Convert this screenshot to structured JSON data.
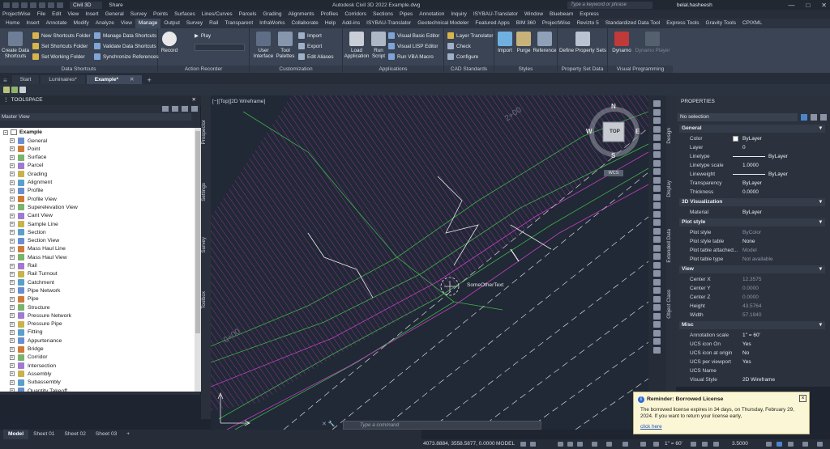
{
  "titlebar": {
    "product": "Civil 3D",
    "share": "Share",
    "app_title": "Autodesk Civil 3D 2022   Example.dwg",
    "search_placeholder": "Type a keyword or phrase",
    "user": "belal.hasheesh",
    "win_min": "—",
    "win_max": "□",
    "win_close": "✕"
  },
  "menu": [
    "ProjectWise",
    "File",
    "Edit",
    "View",
    "Insert",
    "General",
    "Survey",
    "Points",
    "Surfaces",
    "Lines/Curves",
    "Parcels",
    "Grading",
    "Alignments",
    "Profiles",
    "Corridors",
    "Sections",
    "Pipes",
    "Annotation",
    "Inquiry",
    "ISYBAU-Translator",
    "Window",
    "Bluebeam",
    "Express"
  ],
  "ribbon_tabs": [
    "Home",
    "Insert",
    "Annotate",
    "Modify",
    "Analyze",
    "View",
    "Manage",
    "Output",
    "Survey",
    "Rail",
    "Transparent",
    "InfraWorks",
    "Collaborate",
    "Help",
    "Add-ins",
    "ISYBAU-Translator",
    "Geotechnical Modeler",
    "Featured Apps",
    "BIM 360",
    "ProjectWise",
    "Revizto 5",
    "Standardized Data Tool",
    "Express Tools",
    "Gravity Tools",
    "CPIXML"
  ],
  "ribbon_active": "Manage",
  "ribbon": {
    "data_shortcuts": {
      "title": "Data Shortcuts",
      "create": "Create Data Shortcuts",
      "items": [
        "New Shortcuts Folder",
        "Set Shortcuts Folder",
        "Set Working Folder",
        "Manage Data Shortcuts",
        "Validate Data Shortcuts",
        "Synchronize References"
      ]
    },
    "action_recorder": {
      "title": "Action Recorder",
      "record": "Record",
      "play": "Play"
    },
    "customization": {
      "title": "Customization",
      "user_interface": "User Interface",
      "tool_palettes": "Tool Palettes",
      "import": "Import",
      "export": "Export",
      "edit_aliases": "Edit Aliases"
    },
    "applications": {
      "title": "Applications",
      "load_application": "Load Application",
      "run_script": "Run Script",
      "vb_editor": "Visual Basic Editor",
      "lisp_editor": "Visual LISP Editor",
      "vba_macro": "Run VBA Macro"
    },
    "cad_standards": {
      "title": "CAD Standards",
      "layer_translator": "Layer Translator",
      "check": "Check",
      "configure": "Configure"
    },
    "styles": {
      "title": "Styles",
      "import": "Import",
      "purge": "Purge",
      "reference": "Reference"
    },
    "property_set": {
      "title": "Property Set Data",
      "define": "Define Property Sets"
    },
    "visual_programming": {
      "title": "Visual Programming",
      "dynamo": "Dynamo",
      "dynamo_player": "Dynamo Player"
    }
  },
  "doc_tabs": [
    {
      "label": "Start",
      "active": false
    },
    {
      "label": "Luminaires*",
      "active": false
    },
    {
      "label": "Example*",
      "active": true
    }
  ],
  "toolspace": {
    "title": "TOOLSPACE",
    "view": "Master View",
    "root": "Example",
    "items": [
      "General",
      "Point",
      "Surface",
      "Parcel",
      "Grading",
      "Alignment",
      "Profile",
      "Profile View",
      "Superelevation View",
      "Cant View",
      "Sample Line",
      "Section",
      "Section View",
      "Mass Haul Line",
      "Mass Haul View",
      "Rail",
      "Rail Turnout",
      "Catchment",
      "Pipe Network",
      "Pipe",
      "Structure",
      "Pressure Network",
      "Pressure Pipe",
      "Fitting",
      "Appurtenance",
      "Bridge",
      "Corridor",
      "Intersection",
      "Assembly",
      "Subassembly",
      "Quantity Takeoff"
    ],
    "side_tabs": [
      "Prospector",
      "Settings",
      "Survey",
      "Toolbox"
    ]
  },
  "viewport": {
    "label": "[−][Top][2D Wireframe]",
    "viewcube_face": "TOP",
    "compass": {
      "n": "N",
      "s": "S",
      "e": "E",
      "w": "W"
    },
    "wcs": "WCS",
    "annotation": "SomeOtherText",
    "station_labels": [
      "2+00",
      "0+00"
    ],
    "command_placeholder": "Type a command"
  },
  "properties": {
    "title": "PROPERTIES",
    "selection": "No selection",
    "side_tabs": [
      "Design",
      "Display",
      "Extended Data",
      "Object Class"
    ],
    "categories": [
      {
        "name": "General",
        "rows": [
          {
            "k": "Color",
            "v": "ByLayer"
          },
          {
            "k": "Layer",
            "v": "0"
          },
          {
            "k": "Linetype",
            "v": "ByLayer"
          },
          {
            "k": "Linetype scale",
            "v": "1.0000"
          },
          {
            "k": "Lineweight",
            "v": "ByLayer"
          },
          {
            "k": "Transparency",
            "v": "ByLayer"
          },
          {
            "k": "Thickness",
            "v": "0.0000"
          }
        ]
      },
      {
        "name": "3D Visualization",
        "rows": [
          {
            "k": "Material",
            "v": "ByLayer"
          }
        ]
      },
      {
        "name": "Plot style",
        "rows": [
          {
            "k": "Plot style",
            "v": "ByColor",
            "dim": true
          },
          {
            "k": "Plot style table",
            "v": "None"
          },
          {
            "k": "Plot table attached...",
            "v": "Model",
            "dim": true
          },
          {
            "k": "Plot table type",
            "v": "Not available",
            "dim": true
          }
        ]
      },
      {
        "name": "View",
        "rows": [
          {
            "k": "Center X",
            "v": "12.3575",
            "dim": true
          },
          {
            "k": "Center Y",
            "v": "0.0000",
            "dim": true
          },
          {
            "k": "Center Z",
            "v": "0.0000",
            "dim": true
          },
          {
            "k": "Height",
            "v": "43.5764",
            "dim": true
          },
          {
            "k": "Width",
            "v": "57.1940",
            "dim": true
          }
        ]
      },
      {
        "name": "Misc",
        "rows": [
          {
            "k": "Annotation scale",
            "v": "1\" = 60'"
          },
          {
            "k": "UCS icon On",
            "v": "Yes"
          },
          {
            "k": "UCS icon at origin",
            "v": "No"
          },
          {
            "k": "UCS per viewport",
            "v": "Yes"
          },
          {
            "k": "UCS Name",
            "v": ""
          },
          {
            "k": "Visual Style",
            "v": "2D Wireframe"
          }
        ]
      }
    ]
  },
  "layout_tabs": [
    {
      "label": "Model",
      "active": true
    },
    {
      "label": "Sheet 01",
      "active": false
    },
    {
      "label": "Sheet 02",
      "active": false
    },
    {
      "label": "Sheet 03",
      "active": false
    },
    {
      "label": "+",
      "active": false
    }
  ],
  "status": {
    "coords": "4073.8884, 3558.5877, 0.0000",
    "model": "MODEL",
    "scale": "1\" = 60'",
    "value": "3.5000"
  },
  "notification": {
    "title": "Reminder: Borrowed License",
    "body": "The borrowed license expires in 34 days, on Thursday, February 29, 2024. If you want to return your license early,",
    "link": "click here"
  },
  "colors": {
    "viewport_bg": "#212836",
    "hatch_magenta": "#c040c0",
    "line_green": "#3fb04a",
    "line_white": "#e6e6e6"
  }
}
